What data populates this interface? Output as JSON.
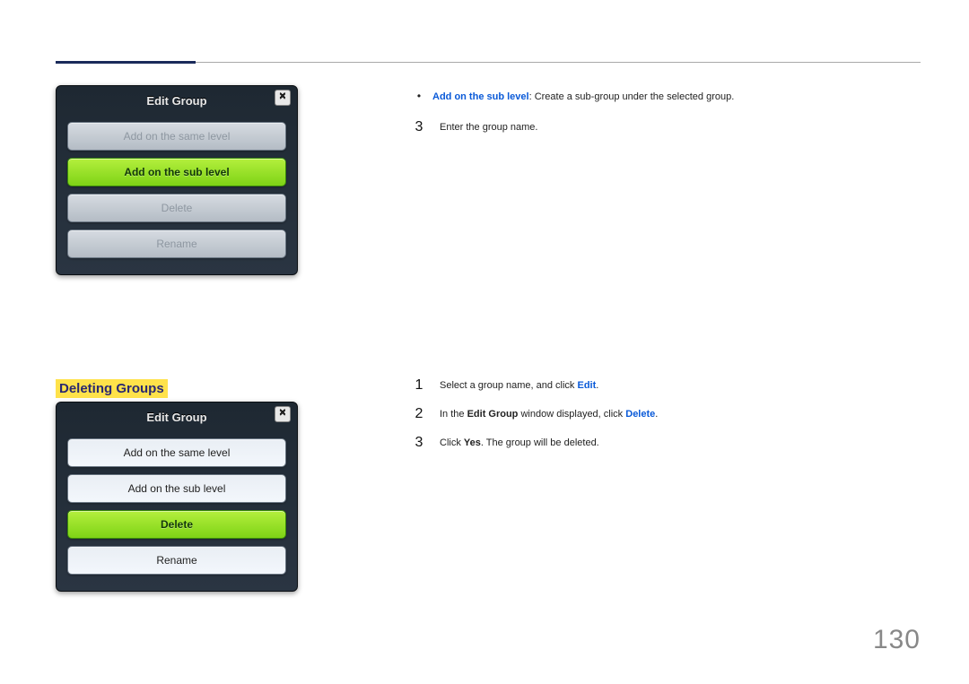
{
  "pageNumber": "130",
  "dialog1": {
    "title": "Edit Group",
    "closeGlyph": "✕",
    "optSameLevel": "Add on the same level",
    "optSubLevel": "Add on the sub level",
    "optDelete": "Delete",
    "optRename": "Rename"
  },
  "dialog2": {
    "title": "Edit Group",
    "closeGlyph": "✕",
    "optSameLevel": "Add on the same level",
    "optSubLevel": "Add on the sub level",
    "optDelete": "Delete",
    "optRename": "Rename"
  },
  "section1": {
    "bulletDot": "•",
    "bulletBold": "Add on the sub level",
    "bulletRest": ": Create a sub-group under the selected group.",
    "step3num": "3",
    "step3text": "Enter the group name."
  },
  "heading2": "Deleting Groups",
  "section2": {
    "step1num": "1",
    "step1a": "Select a group name, and click ",
    "step1b": "Edit",
    "step1c": ".",
    "step2num": "2",
    "step2a": "In the ",
    "step2b": "Edit Group",
    "step2c": " window displayed, click ",
    "step2d": "Delete",
    "step2e": ".",
    "step3num": "3",
    "step3a": "Click ",
    "step3b": "Yes",
    "step3c": ". The group will be deleted."
  }
}
